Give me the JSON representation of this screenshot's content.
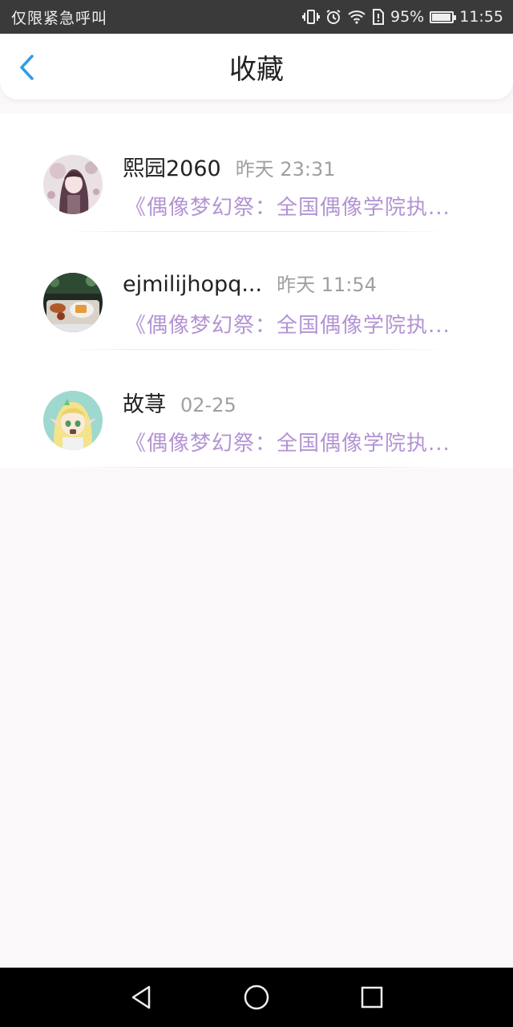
{
  "status_bar": {
    "carrier_text": "仅限紧急呼叫",
    "battery_percent": "95%",
    "battery_level": 0.95,
    "time": "11:55",
    "icons": [
      "vibrate-icon",
      "alarm-icon",
      "wifi-icon",
      "sim-icon",
      "battery-icon"
    ]
  },
  "header": {
    "title": "收藏",
    "back_icon": "chevron-left-icon"
  },
  "favorites": [
    {
      "user": "熙园2060",
      "time": "昨天 23:31",
      "preview": "《偶像梦幻祭：全国偶像学院执...",
      "avatar": "anime-girl-avatar"
    },
    {
      "user": "ejmilijhopq...",
      "time": "昨天 11:54",
      "preview": "《偶像梦幻祭：全国偶像学院执...",
      "avatar": "food-photo-avatar"
    },
    {
      "user": "故荨",
      "time": "02-25",
      "preview": "《偶像梦幻祭：全国偶像学院执...",
      "avatar": "elf-girl-avatar"
    }
  ],
  "colors": {
    "accent": "#2f9ee3",
    "preview_text": "#b393d3",
    "background": "#faf8f9",
    "status_bar": "#3a3a3a"
  },
  "nav_bar": {
    "buttons": [
      "back-triangle-icon",
      "home-circle-icon",
      "recents-square-icon"
    ]
  }
}
